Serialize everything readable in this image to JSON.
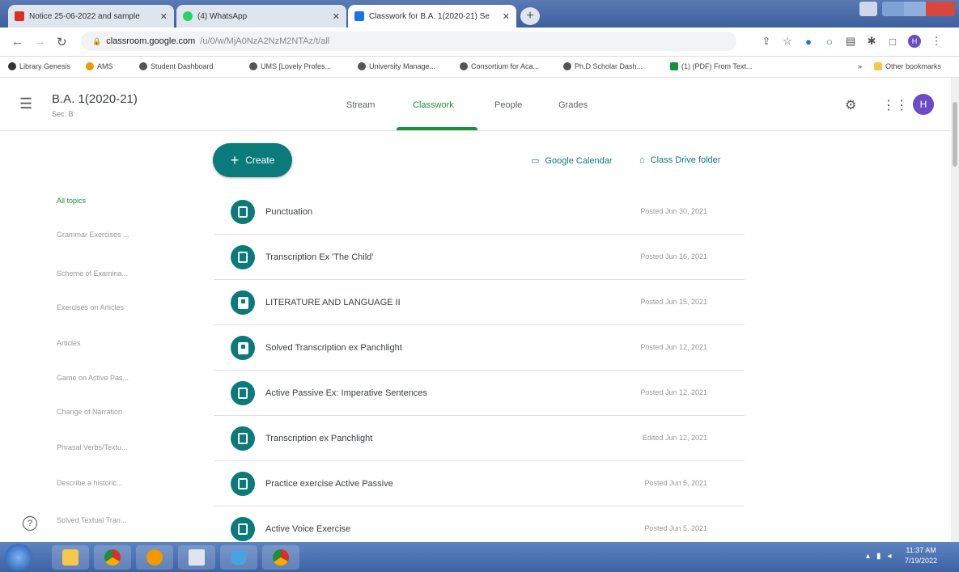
{
  "browser": {
    "tabs": [
      {
        "title": "Notice 25-06-2022 and sample",
        "color": "#d93025"
      },
      {
        "title": "(4) WhatsApp",
        "color": "#25d366"
      },
      {
        "title": "Classwork for B.A. 1(2020-21) Se",
        "color": "#1a73e8"
      }
    ],
    "address": {
      "host": "classroom.google.com",
      "path": "/u/0/w/MjA0NzA2NzM2NTAz/t/all"
    },
    "bookmarks": [
      "Library Genesis",
      "AMS",
      "Student Dashboard",
      "UMS [Lovely Profes...",
      "University Manage...",
      "Consortium for Aca...",
      "Ph.D Scholar Dash...",
      "(1) (PDF) From Text..."
    ],
    "other_bookmarks": "Other bookmarks",
    "profile_initial": "H"
  },
  "classroom": {
    "class_title": "B.A. 1(2020-21)",
    "class_section": "Sec. B",
    "tabs": [
      "Stream",
      "Classwork",
      "People",
      "Grades"
    ],
    "active_tab": "Classwork",
    "avatar_initial": "H",
    "create_label": "Create",
    "calendar_label": "Google Calendar",
    "drive_label": "Class Drive folder",
    "topics": [
      "All topics",
      "Grammar Exercises ...",
      "Scheme of Examina...",
      "Exercises on Articles",
      "Articles",
      "Game on Active Pas...",
      "Change of Narration",
      "Phrasal Verbs/Textu...",
      "Describe a historic...",
      "Solved Textual Tran..."
    ],
    "items": [
      {
        "title": "Punctuation",
        "date": "Posted Jun 30, 2021",
        "icon": "assignment-icon"
      },
      {
        "title": "Transcription Ex 'The Child'",
        "date": "Posted Jun 16, 2021",
        "icon": "assignment-icon"
      },
      {
        "title": "LITERATURE AND LANGUAGE II",
        "date": "Posted Jun 15, 2021",
        "icon": "material-icon"
      },
      {
        "title": "Solved Transcription ex Panchlight",
        "date": "Posted Jun 12, 2021",
        "icon": "material-icon"
      },
      {
        "title": "Active Passive Ex: Imperative Sentences",
        "date": "Posted Jun 12, 2021",
        "icon": "assignment-icon"
      },
      {
        "title": "Transcription ex Panchlight",
        "date": "Edited Jun 12, 2021",
        "icon": "assignment-icon"
      },
      {
        "title": "Practice exercise Active Passive",
        "date": "Posted Jun 5, 2021",
        "icon": "assignment-icon"
      },
      {
        "title": "Active Voice Exercise",
        "date": "Posted Jun 5, 2021",
        "icon": "assignment-icon"
      }
    ]
  },
  "system": {
    "time": "11:37 AM",
    "date": "7/19/2022"
  },
  "colors": {
    "accent": "#0b7a7a",
    "active_tab": "#1e8e3e",
    "avatar": "#6a4cc7"
  }
}
